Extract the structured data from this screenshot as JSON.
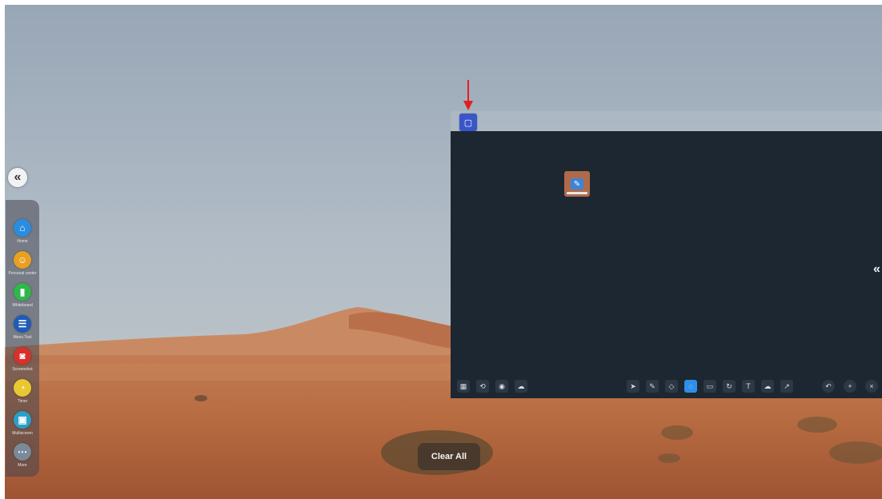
{
  "desktop": {
    "sky_color": "#a9b7c4",
    "sand_color": "#c0754a"
  },
  "left_dock": {
    "items": [
      {
        "label": "Home",
        "icon": "home-icon",
        "glyph": "⌂",
        "color": "#2a8de0"
      },
      {
        "label": "Personal center",
        "icon": "user-icon",
        "glyph": "☺",
        "color": "#e8a020"
      },
      {
        "label": "Whiteboard",
        "icon": "whiteboard-icon",
        "glyph": "▮",
        "color": "#2fb84a"
      },
      {
        "label": "Menu Tool",
        "icon": "menu-icon",
        "glyph": "☰",
        "color": "#1f5bb8"
      },
      {
        "label": "Screenshot",
        "icon": "camera-icon",
        "glyph": "◙",
        "color": "#d8302a"
      },
      {
        "label": "Timer",
        "icon": "timer-icon",
        "glyph": "◔",
        "color": "#e8c830"
      },
      {
        "label": "Multiscreen",
        "icon": "screen-share-icon",
        "glyph": "▣",
        "color": "#2aa0c8"
      },
      {
        "label": "More",
        "icon": "more-icon",
        "glyph": "⋯",
        "color": "#7a8a98"
      }
    ]
  },
  "window": {
    "badge_icon": "window-icon",
    "app_icon": "whiteboard-app-icon"
  },
  "toolbar": {
    "left_buttons": [
      {
        "icon": "menu-grid-icon",
        "glyph": "▦"
      },
      {
        "icon": "back-icon",
        "glyph": "⟲"
      },
      {
        "icon": "eye-icon",
        "glyph": "◉"
      },
      {
        "icon": "cloud-icon",
        "glyph": "☁"
      }
    ],
    "center_buttons": [
      {
        "icon": "cursor-icon",
        "glyph": "➤",
        "active": false
      },
      {
        "icon": "pen-icon",
        "glyph": "✎",
        "active": false
      },
      {
        "icon": "eraser-icon",
        "glyph": "◇",
        "active": false
      },
      {
        "icon": "select-icon",
        "glyph": "◌",
        "active": true
      },
      {
        "icon": "shape-icon",
        "glyph": "▭",
        "active": false
      },
      {
        "icon": "rotate-icon",
        "glyph": "↻",
        "active": false
      },
      {
        "icon": "text-icon",
        "glyph": "T",
        "active": false
      },
      {
        "icon": "cloud-tool-icon",
        "glyph": "☁",
        "active": false
      },
      {
        "icon": "pointer-icon",
        "glyph": "↗",
        "active": false
      }
    ],
    "right_buttons": [
      {
        "icon": "undo-icon",
        "glyph": "↶"
      },
      {
        "icon": "add-icon",
        "glyph": "+"
      },
      {
        "icon": "close-icon",
        "glyph": "×"
      }
    ]
  },
  "clear_all_label": "Clear All",
  "accent_arrow_color": "#e02020"
}
